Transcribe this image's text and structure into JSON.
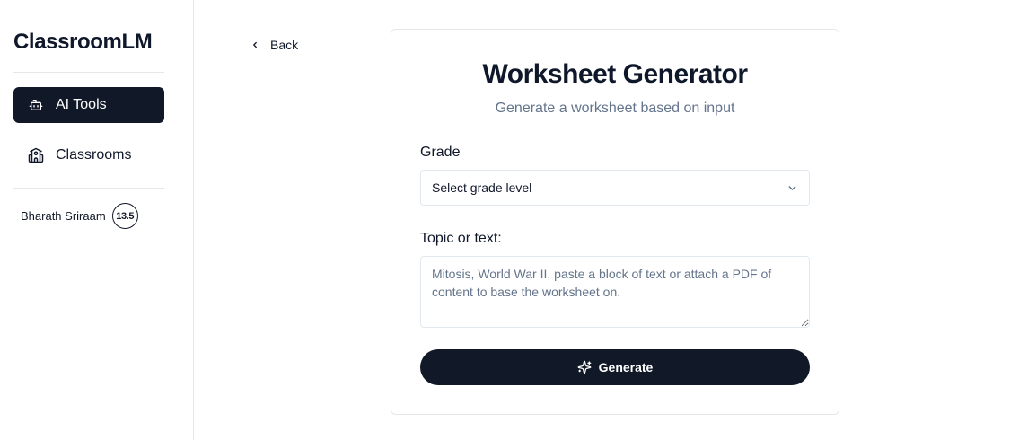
{
  "sidebar": {
    "brand": "ClassroomLM",
    "items": [
      {
        "label": "AI Tools",
        "icon": "bot-icon",
        "active": true
      },
      {
        "label": "Classrooms",
        "icon": "school-icon",
        "active": false
      }
    ],
    "user": {
      "name": "Bharath Sriraam",
      "credits": "13.5"
    }
  },
  "nav": {
    "back_label": "Back"
  },
  "card": {
    "title": "Worksheet Generator",
    "subtitle": "Generate a worksheet based on input",
    "grade_label": "Grade",
    "grade_placeholder": "Select grade level",
    "topic_label": "Topic or text:",
    "topic_placeholder": "Mitosis, World War II, paste a block of text or attach a PDF of content to base the worksheet on.",
    "generate_label": "Generate"
  },
  "colors": {
    "primary": "#111827",
    "muted": "#64748b",
    "border": "#e5e7eb"
  }
}
